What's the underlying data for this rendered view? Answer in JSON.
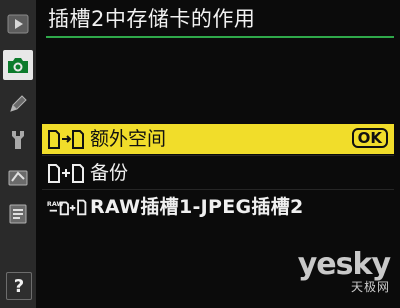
{
  "header": {
    "title": "插槽2中存储卡的作用"
  },
  "sidebar": {
    "items": [
      {
        "icon": "playback-icon",
        "active": false
      },
      {
        "icon": "camera-icon",
        "active": true
      },
      {
        "icon": "pencil-icon",
        "active": false
      },
      {
        "icon": "wrench-icon",
        "active": false
      },
      {
        "icon": "retouch-icon",
        "active": false
      },
      {
        "icon": "my-menu-icon",
        "active": false
      }
    ],
    "help_label": "?"
  },
  "options": [
    {
      "label": "额外空间",
      "icon": "overflow-icon",
      "selected": true
    },
    {
      "label": "备份",
      "icon": "backup-icon",
      "selected": false
    },
    {
      "label": "RAW插槽1-JPEG插槽2",
      "icon": "raw-jpeg-icon",
      "selected": false
    }
  ],
  "ok_label": "OK",
  "watermark": {
    "brand": "yesky",
    "subtitle": "天极网"
  },
  "colors": {
    "accent_green": "#2fa84a",
    "highlight_yellow": "#f1dd2a",
    "sidebar_bg": "#2a2a2a",
    "background": "#0b0b0b"
  }
}
